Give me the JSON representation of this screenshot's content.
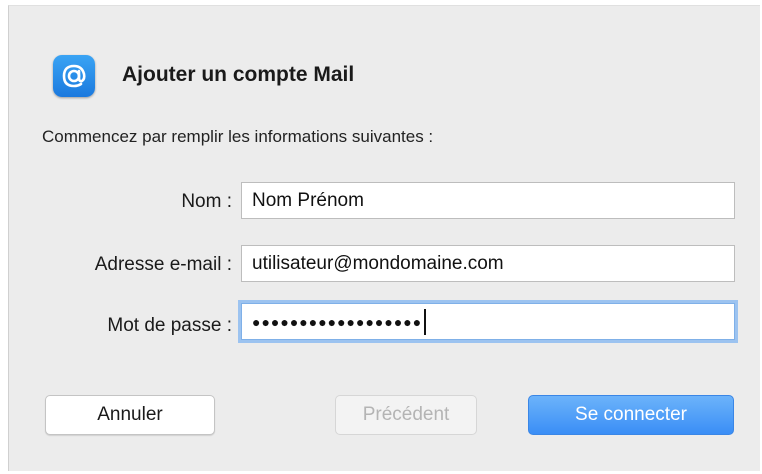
{
  "dialog": {
    "title": "Ajouter un compte Mail",
    "subtitle": "Commencez par remplir les informations suivantes :",
    "app_icon": "at-sign-icon"
  },
  "fields": {
    "name": {
      "label": "Nom :",
      "value": "Nom Prénom"
    },
    "email": {
      "label": "Adresse e-mail :",
      "value": "utilisateur@mondomaine.com"
    },
    "password": {
      "label": "Mot de passe :",
      "masked_value": "●●●●●●●●●●●●●●●●●●"
    }
  },
  "buttons": {
    "cancel": "Annuler",
    "previous": "Précédent",
    "connect": "Se connecter"
  },
  "colors": {
    "accent": "#3a8ef6",
    "focus_ring": "#9cc3f0",
    "dialog_bg": "#ececec"
  }
}
